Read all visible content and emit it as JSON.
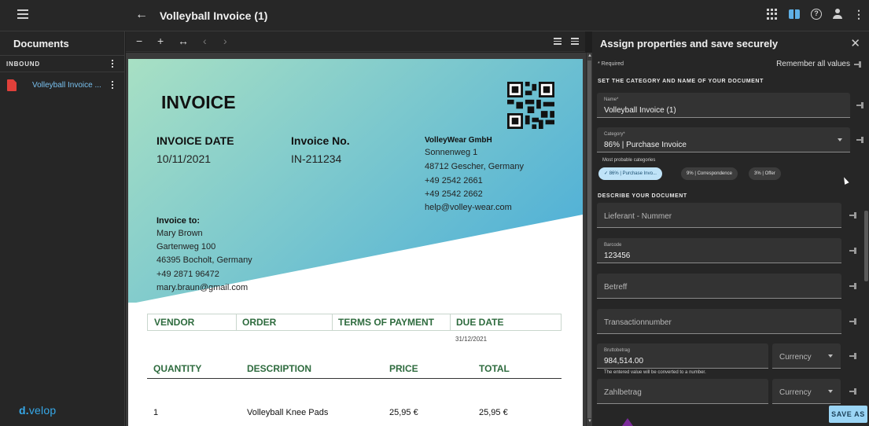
{
  "app": {
    "title": "Volleyball Invoice (1)",
    "brand": {
      "part1": "d.",
      "part2": "velop"
    }
  },
  "sidebar": {
    "title": "Documents",
    "section": "INBOUND",
    "items": [
      {
        "label": "Volleyball Invoice ...",
        "icon": "pdf-icon"
      }
    ]
  },
  "toolbar": {
    "zoom_out": "−",
    "zoom_in": "+",
    "fit_width": "↔",
    "prev": "‹",
    "next": "›"
  },
  "invoice": {
    "title": "INVOICE",
    "date_label": "INVOICE DATE",
    "date_value": "10/11/2021",
    "number_label": "Invoice No.",
    "number_value": "IN-211234",
    "vendor_name": "VolleyWear GmbH",
    "vendor_lines": [
      "Sonnenweg 1",
      "48712 Gescher, Germany",
      "+49 2542 2661",
      "+49 2542 2662",
      "help@volley-wear.com"
    ],
    "to_label": "Invoice to:",
    "to_lines": [
      "Mary Brown",
      "Gartenweg 100",
      "46395 Bocholt, Germany",
      "+49 2871 96472",
      "mary.braun@gmail.com"
    ],
    "table1_headers": [
      "VENDOR",
      "ORDER",
      "TERMS OF PAYMENT",
      "DUE DATE"
    ],
    "due_date": "31/12/2021",
    "table2_headers": [
      "QUANTITY",
      "DESCRIPTION",
      "PRICE",
      "TOTAL"
    ],
    "rows": [
      {
        "quantity": "1",
        "description": "Volleyball Knee Pads",
        "price": "25,95 €",
        "total": "25,95 €"
      }
    ],
    "gradient_from": "#a8e0c4",
    "gradient_to": "#55b3d6"
  },
  "panel": {
    "title": "Assign properties and save securely",
    "required_note": "* Required",
    "remember_all": "Remember all values",
    "section_category": "SET THE CATEGORY AND NAME OF YOUR DOCUMENT",
    "name_field": {
      "label": "Name*",
      "value": "Volleyball Invoice (1)"
    },
    "category_field": {
      "label": "Category*",
      "value": "86% | Purchase Invoice"
    },
    "most_probable_label": "Most probable categories",
    "chips": [
      "86% | Purchase Invo...",
      "9% | Correspondence",
      "3% | Offer"
    ],
    "section_describe": "DESCRIBE YOUR DOCUMENT",
    "fields": {
      "lieferant": {
        "placeholder": "Lieferant - Nummer"
      },
      "barcode": {
        "label": "Barcode",
        "value": "123456"
      },
      "betreff": {
        "placeholder": "Betreff"
      },
      "transaction": {
        "placeholder": "Transactionnumber"
      },
      "brutto": {
        "label": "Bruttobetrag",
        "value": "984,514.00",
        "currency": "Currency"
      },
      "zahl": {
        "placeholder": "Zahlbetrag",
        "currency": "Currency"
      }
    },
    "conversion_hint": "The entered value will be converted to a number.",
    "save_button": "SAVE AS",
    "accent": "#9bd5f5"
  }
}
